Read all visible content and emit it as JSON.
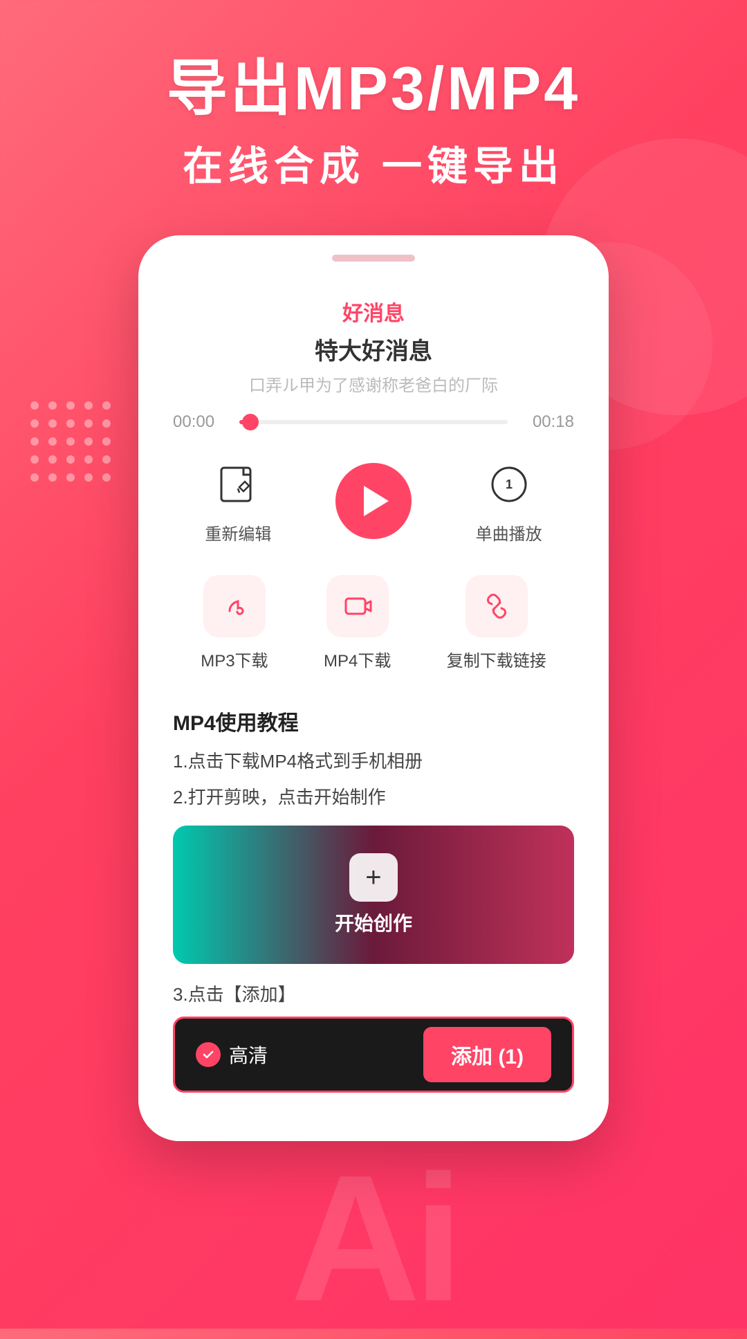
{
  "header": {
    "main_title": "导出MP3/MP4",
    "sub_title": "在线合成 一键导出"
  },
  "song": {
    "label": "好消息",
    "title": "特大好消息",
    "desc": "口弄ル甲为了感谢称老爸白的厂际",
    "time_start": "00:00",
    "time_end": "00:18"
  },
  "controls": [
    {
      "label": "重新编辑",
      "type": "edit"
    },
    {
      "label": "",
      "type": "play"
    },
    {
      "label": "单曲播放",
      "type": "loop"
    }
  ],
  "downloads": [
    {
      "label": "MP3下载",
      "type": "mp3"
    },
    {
      "label": "MP4下载",
      "type": "mp4"
    },
    {
      "label": "复制下载链接",
      "type": "link"
    }
  ],
  "tutorial": {
    "title": "MP4使用教程",
    "steps": [
      "1.点击下载MP4格式到手机相册",
      "2.打开剪映，点击开始制作"
    ],
    "create_label": "开始创作",
    "step3": "3.点击【添加】"
  },
  "add_bar": {
    "hd_label": "高清",
    "add_label": "添加 (1)"
  },
  "ai_text": "Ai"
}
